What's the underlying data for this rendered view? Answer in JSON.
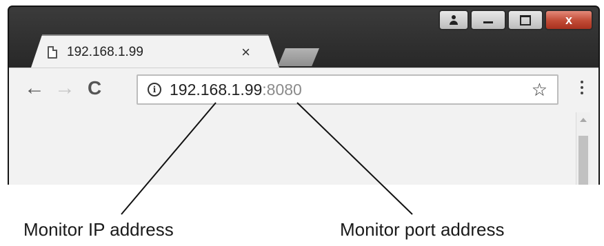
{
  "window": {
    "caption_buttons": {
      "user_icon": "user-icon",
      "minimize_icon": "minimize-icon",
      "maximize_icon": "maximize-icon",
      "close_label": "x"
    }
  },
  "tabs": [
    {
      "title": "192.168.1.99",
      "icon": "page-icon",
      "close_label": "×"
    }
  ],
  "toolbar": {
    "back_icon": "←",
    "forward_icon": "→",
    "reload_icon": "C",
    "omnibox": {
      "info_icon": "i",
      "host": "192.168.1.99",
      "port": ":8080"
    },
    "star_icon": "☆"
  },
  "annotations": {
    "ip_label": "Monitor IP address",
    "port_label": "Monitor port address"
  },
  "colors": {
    "frame": "#1f1f1f",
    "close_button": "#c14a35",
    "chrome_bg": "#f2f2f2",
    "port_text": "#8a8a8a"
  }
}
